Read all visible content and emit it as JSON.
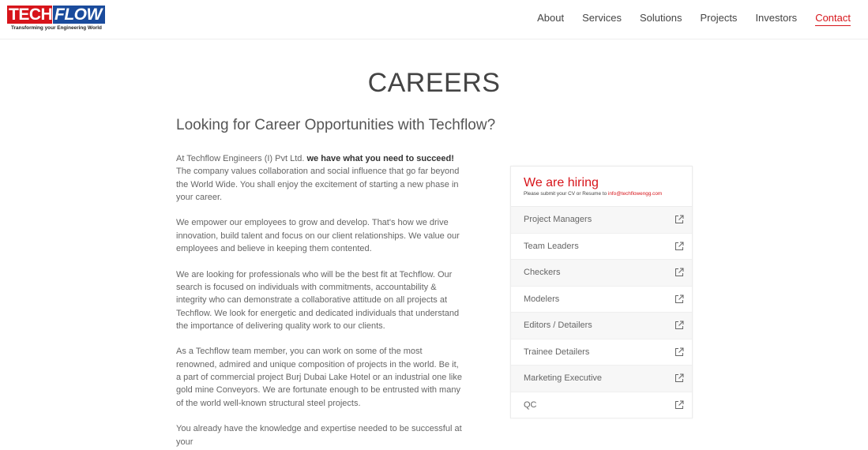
{
  "brand": {
    "logo_tech": "TECH",
    "logo_flow": "FLOW",
    "tagline": "Transforming your Engineering World",
    "colors": {
      "red": "#d7141a",
      "blue": "#1a4b9c"
    }
  },
  "nav": {
    "items": [
      "About",
      "Services",
      "Solutions",
      "Projects",
      "Investors",
      "Contact"
    ],
    "active": "Contact"
  },
  "page": {
    "title": "CAREERS",
    "subtitle": "Looking for Career Opportunities with Techflow?"
  },
  "content": {
    "p1_start": "At Techflow Engineers (I) Pvt Ltd. ",
    "p1_bold": "we have what you need to succeed!",
    "p1_end": " The company values collaboration and social influence that go far beyond the World Wide. You shall enjoy the excitement of starting a new phase in your career.",
    "p2": "We empower our employees to grow and develop. That's how we drive innovation, build talent and focus on our client relationships. We value our employees and believe in keeping them contented.",
    "p3": "We are looking for professionals who will be the best fit at Techflow. Our search is focused on individuals with commitments, accountability & integrity who can demonstrate a collaborative attitude on all projects at Techflow. We look for energetic and dedicated individuals that understand the importance of delivering quality work to our clients.",
    "p4": "As a Techflow team member, you can work on some of the most renowned, admired and unique composition of projects in the world. Be it, a part of commercial project Burj Dubai Lake Hotel or an industrial one like gold mine Conveyors. We are fortunate enough to be entrusted with many of the world well-known structural steel projects.",
    "p5": "You already have the knowledge and expertise needed to be successful at your"
  },
  "hiring": {
    "title": "We are hiring",
    "note_prefix": "Please submit your CV or Resume to ",
    "email": "info@techflowengg.com",
    "jobs": [
      "Project Managers",
      "Team Leaders",
      "Checkers",
      "Modelers",
      "Editors / Detailers",
      "Trainee Detailers",
      "Marketing Executive",
      "QC"
    ],
    "icon": "external-link-icon"
  }
}
